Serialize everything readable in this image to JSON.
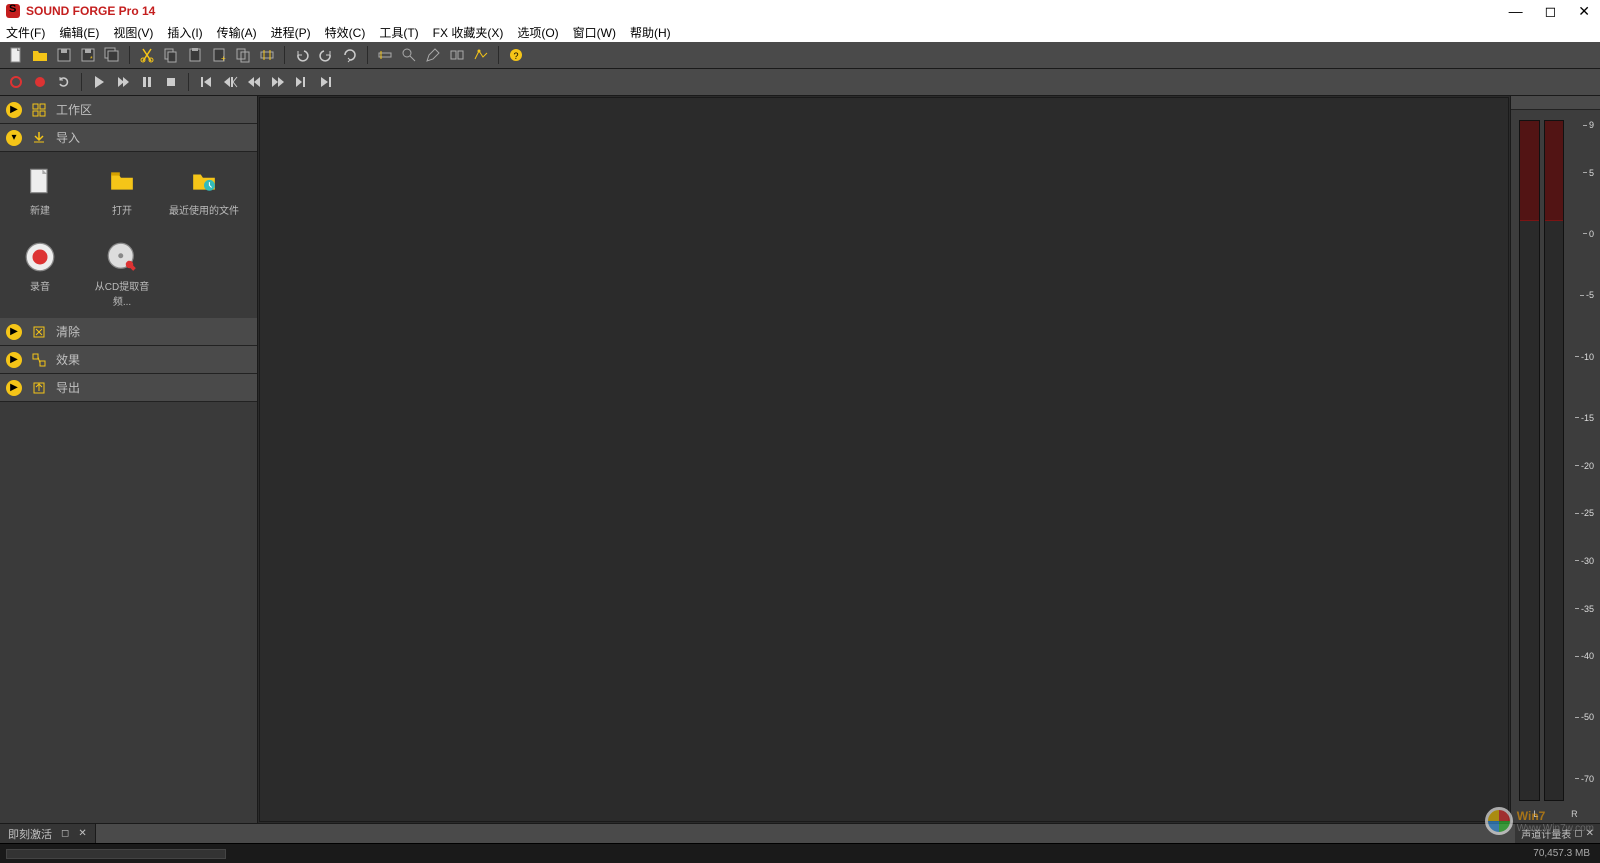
{
  "app": {
    "title": "SOUND FORGE Pro 14"
  },
  "menu": {
    "file": "文件(F)",
    "edit": "编辑(E)",
    "view": "视图(V)",
    "insert": "插入(I)",
    "transfer": "传输(A)",
    "process": "进程(P)",
    "effects": "特效(C)",
    "tools": "工具(T)",
    "fx_fav": "FX 收藏夹(X)",
    "options": "选项(O)",
    "window": "窗口(W)",
    "help": "帮助(H)"
  },
  "sidebar": {
    "sections": {
      "workspace": "工作区",
      "import": "导入",
      "clear": "清除",
      "effects": "效果",
      "export": "导出"
    },
    "import_items": {
      "new": "新建",
      "open": "打开",
      "recent": "最近使用的文件",
      "record": "录音",
      "extract_cd": "从CD提取音频..."
    }
  },
  "bottom": {
    "tab_label": "即刻激活",
    "meter_tab": "声道计量表"
  },
  "meter": {
    "ticks": [
      "9",
      "5",
      "0",
      "-5",
      "-10",
      "-15",
      "-20",
      "-25",
      "-30",
      "-35",
      "-40",
      "-50",
      "-70"
    ],
    "L": "L",
    "R": "R"
  },
  "status": {
    "memory": "70,457.3 MB"
  },
  "watermark": {
    "t1": "Win7",
    "t2": "Www.Win7w.com"
  }
}
